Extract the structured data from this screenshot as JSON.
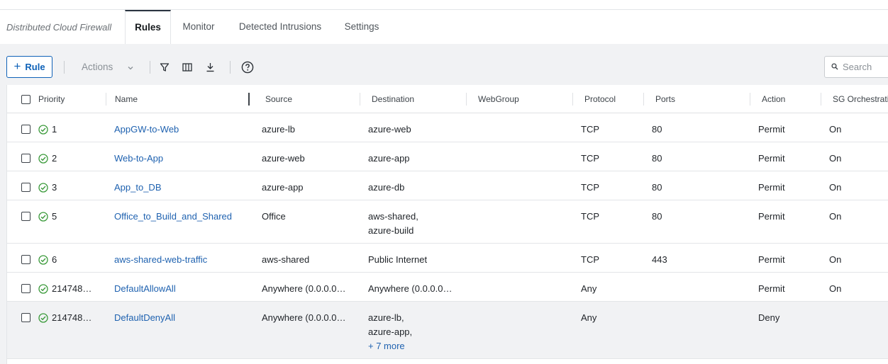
{
  "app": {
    "title": "Distributed Cloud Firewall"
  },
  "tabs": [
    {
      "label": "Rules",
      "active": true
    },
    {
      "label": "Monitor",
      "active": false
    },
    {
      "label": "Detected Intrusions",
      "active": false
    },
    {
      "label": "Settings",
      "active": false
    }
  ],
  "toolbar": {
    "add_rule_label": "Rule",
    "actions_label": "Actions",
    "search_placeholder": "Search",
    "icons": [
      "filter-icon",
      "columns-icon",
      "download-icon",
      "help-icon"
    ]
  },
  "table": {
    "columns": [
      "Priority",
      "Name",
      "Source",
      "Destination",
      "WebGroup",
      "Protocol",
      "Ports",
      "Action",
      "SG Orchestration"
    ],
    "rows": [
      {
        "priority": "1",
        "name": "AppGW-to-Web",
        "source": "azure-lb",
        "destination": [
          "azure-web"
        ],
        "webgroup": "",
        "protocol": "TCP",
        "ports": "80",
        "action": "Permit",
        "sg": "On"
      },
      {
        "priority": "2",
        "name": "Web-to-App",
        "source": "azure-web",
        "destination": [
          "azure-app"
        ],
        "webgroup": "",
        "protocol": "TCP",
        "ports": "80",
        "action": "Permit",
        "sg": "On"
      },
      {
        "priority": "3",
        "name": "App_to_DB",
        "source": "azure-app",
        "destination": [
          "azure-db"
        ],
        "webgroup": "",
        "protocol": "TCP",
        "ports": "80",
        "action": "Permit",
        "sg": "On"
      },
      {
        "priority": "5",
        "name": "Office_to_Build_and_Shared",
        "source": "Office",
        "destination": [
          "aws-shared,",
          "azure-build"
        ],
        "webgroup": "",
        "protocol": "TCP",
        "ports": "80",
        "action": "Permit",
        "sg": "On"
      },
      {
        "priority": "6",
        "name": "aws-shared-web-traffic",
        "source": "aws-shared",
        "destination": [
          "Public Internet"
        ],
        "webgroup": "",
        "protocol": "TCP",
        "ports": "443",
        "action": "Permit",
        "sg": "On"
      },
      {
        "priority": "214748…",
        "name": "DefaultAllowAll",
        "source": "Anywhere (0.0.0.0…",
        "destination": [
          "Anywhere (0.0.0.0…"
        ],
        "webgroup": "",
        "protocol": "Any",
        "ports": "",
        "action": "Permit",
        "sg": "On"
      },
      {
        "priority": "214748…",
        "name": "DefaultDenyAll",
        "source": "Anywhere (0.0.0.0…",
        "destination": [
          "azure-lb,",
          "azure-app,"
        ],
        "destination_more": "+ 7 more",
        "webgroup": "",
        "protocol": "Any",
        "ports": "",
        "action": "Deny",
        "sg": ""
      }
    ]
  },
  "colors": {
    "accent": "#0f62b8",
    "link": "#1f62b0",
    "status_ok": "#3a9a3a"
  }
}
